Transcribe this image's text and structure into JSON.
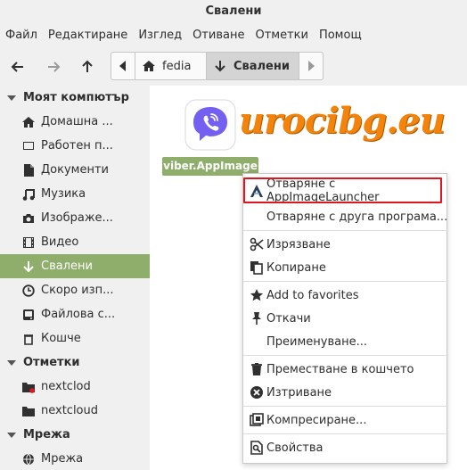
{
  "window": {
    "title": "Свалени"
  },
  "menu": [
    "Файл",
    "Редактиране",
    "Изглед",
    "Отиване",
    "Отметки",
    "Помощ"
  ],
  "toolbar": {
    "back_icon": "arrow-left-icon",
    "forward_icon": "arrow-right-icon",
    "up_icon": "arrow-up-icon"
  },
  "path": {
    "home": "fedia",
    "current": "Свалени"
  },
  "sidebar": {
    "computer_header": "Моят компютър",
    "computer_items": [
      {
        "label": "Домашна ...",
        "icon": "home-icon"
      },
      {
        "label": "Работен п...",
        "icon": "desktop-icon"
      },
      {
        "label": "Документи",
        "icon": "document-icon"
      },
      {
        "label": "Музика",
        "icon": "music-icon"
      },
      {
        "label": "Изображе...",
        "icon": "camera-icon"
      },
      {
        "label": "Видео",
        "icon": "film-icon"
      },
      {
        "label": "Свалени",
        "icon": "download-icon"
      },
      {
        "label": "Скоро изп...",
        "icon": "clock-icon"
      },
      {
        "label": "Файлова с...",
        "icon": "drive-icon"
      },
      {
        "label": "Кошче",
        "icon": "trash-icon"
      }
    ],
    "bookmarks_header": "Отметки",
    "bookmark_items": [
      {
        "label": "nextclod",
        "icon": "folder-error-icon"
      },
      {
        "label": "nextcloud",
        "icon": "folder-icon"
      }
    ],
    "network_header": "Мрежа",
    "network_items": [
      {
        "label": "Мрежа",
        "icon": "network-icon"
      }
    ]
  },
  "file": {
    "name": "viber.AppImage",
    "icon": "viber-icon"
  },
  "watermark": "urocibg.eu",
  "context_menu": {
    "open_appimage": "Отваряне с AppImageLauncher",
    "open_other": "Отваряне с друга програма...",
    "cut": "Изрязване",
    "copy": "Копиране",
    "favorites": "Add to favorites",
    "pin": "Откачи",
    "rename": "Преименуване...",
    "move_trash": "Преместване в кошчето",
    "delete": "Изтриване",
    "compress": "Компресиране...",
    "properties": "Свойства"
  },
  "colors": {
    "accent": "#8fad6b",
    "highlight": "#e0161e",
    "watermark": "#f4830b",
    "viber": "#7360f2"
  }
}
